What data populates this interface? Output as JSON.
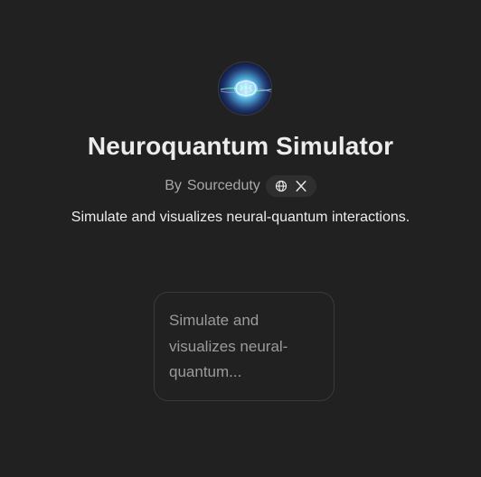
{
  "gpt": {
    "name": "Neuroquantum Simulator",
    "author_prefix": "By",
    "author": "Sourceduty",
    "description": "Simulate and visualizes neural-quantum interactions.",
    "avatar_icon": "brain-icon"
  },
  "badge": {
    "icons": [
      "globe-icon",
      "x-logo-icon"
    ]
  },
  "starter": {
    "text": "Simulate and visualizes neural-quantum..."
  },
  "colors": {
    "background": "#212121",
    "text": "#ececec",
    "muted": "#a8a8a8"
  }
}
